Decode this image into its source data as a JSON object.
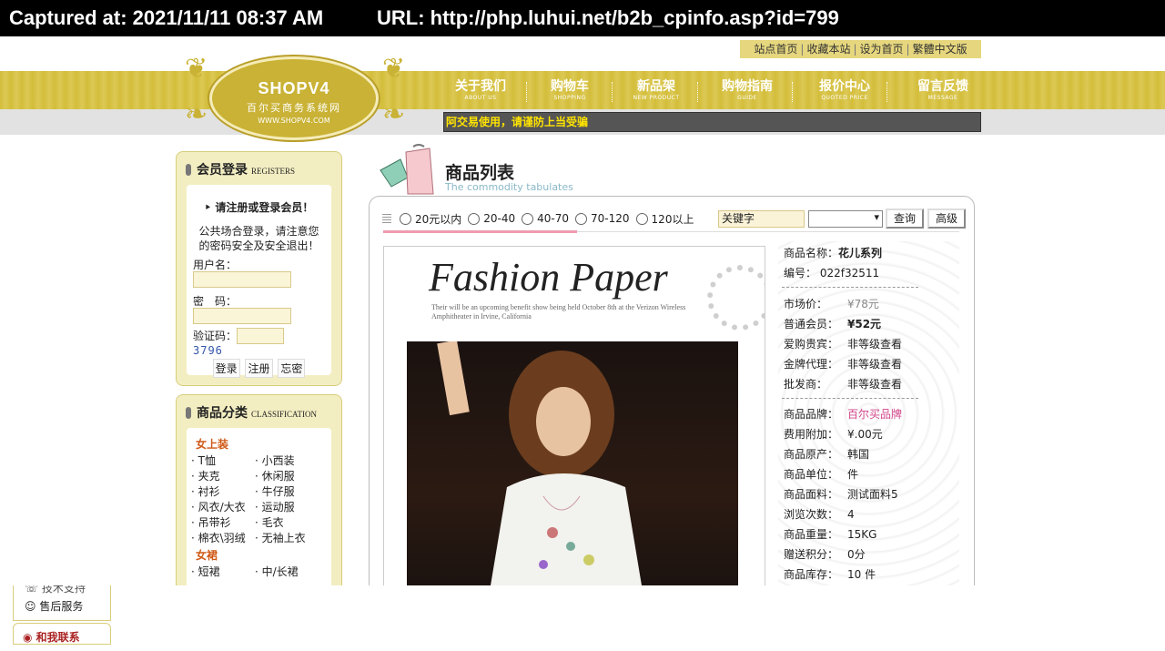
{
  "capture": {
    "captured_at": "Captured at: 2021/11/11 08:37 AM",
    "url": "URL: http://php.luhui.net/b2b_cpinfo.asp?id=799"
  },
  "toplinks": [
    "站点首页",
    "收藏本站",
    "设为首页",
    "繁體中文版"
  ],
  "logo": {
    "title": "SHOPV4",
    "subtitle": "百尔买商务系统网",
    "domain": "WWW.SHOPV4.COM"
  },
  "nav": [
    {
      "cn": "关于我们",
      "en": "ABOUT US"
    },
    {
      "cn": "购物车",
      "en": "SHOPPING"
    },
    {
      "cn": "新品架",
      "en": "NEW PRODUCT"
    },
    {
      "cn": "购物指南",
      "en": "GUIDE"
    },
    {
      "cn": "报价中心",
      "en": "QUOTED PRICE"
    },
    {
      "cn": "留言反馈",
      "en": "MESSAGE"
    }
  ],
  "marquee": "阿交易使用，请谨防上当受骗",
  "login": {
    "title": "会员登录",
    "title_en": "REGISTERS",
    "notice": "请注册或登录会员！",
    "tip": "公共场合登录，请注意您的密码安全及安全退出！",
    "username_label": "用户名：",
    "password_label": "密　码：",
    "captcha_label": "验证码：",
    "captcha": "3796",
    "buttons": [
      "登录",
      "注册",
      "忘密"
    ]
  },
  "category": {
    "title": "商品分类",
    "title_en": "CLASSIFICATION",
    "groups": [
      {
        "name": "女上装",
        "rows": [
          [
            "T恤",
            "小西装"
          ],
          [
            "夹克",
            "休闲服"
          ],
          [
            "衬衫",
            "牛仔服"
          ],
          [
            "风衣/大衣",
            "运动服"
          ],
          [
            "吊带衫",
            "毛衣"
          ],
          [
            "棉衣\\羽绒",
            "无袖上衣"
          ]
        ]
      },
      {
        "name": "女裙",
        "rows": [
          [
            "短裙",
            "中/长裙"
          ]
        ]
      }
    ]
  },
  "content": {
    "title": "商品列表",
    "title_en": "The commodity tabulates",
    "filters": [
      "20元以内",
      "20-40",
      "40-70",
      "70-120",
      "120以上"
    ],
    "keyword_value": "关键字",
    "search_btn": "查询",
    "advanced_btn": "高级",
    "image_title": "Fashion Paper",
    "image_sub": "Their will be an upcoming benefit show being held October 8th at the Verizon Wireless Amphitheater in Irvine, California"
  },
  "product": {
    "name_label": "商品名称：",
    "name": "花儿系列",
    "code_label": "编号：",
    "code": "022f32511",
    "market_label": "市场价：",
    "market": "¥78元",
    "member_label": "普通会员：",
    "member": "¥52元",
    "vip_label": "爱购贵宾：",
    "vip": "非等级查看",
    "gold_label": "金牌代理：",
    "gold": "非等级查看",
    "whole_label": "批发商：",
    "whole": "非等级查看",
    "brand_label": "商品品牌：",
    "brand": "百尔买品牌",
    "fee_label": "费用附加：",
    "fee": "¥.00元",
    "origin_label": "商品原产：",
    "origin": "韩国",
    "unit_label": "商品单位：",
    "unit": "件",
    "material_label": "商品面料：",
    "material": "测试面料5",
    "views_label": "浏览次数：",
    "views": "4",
    "weight_label": "商品重量：",
    "weight": "15KG",
    "points_label": "赠送积分：",
    "points": "0分",
    "stock_label": "商品库存：",
    "stock": "10 件"
  },
  "stub": {
    "line1": "技术支持",
    "line2": "售后服务",
    "line3": "和我联系"
  }
}
